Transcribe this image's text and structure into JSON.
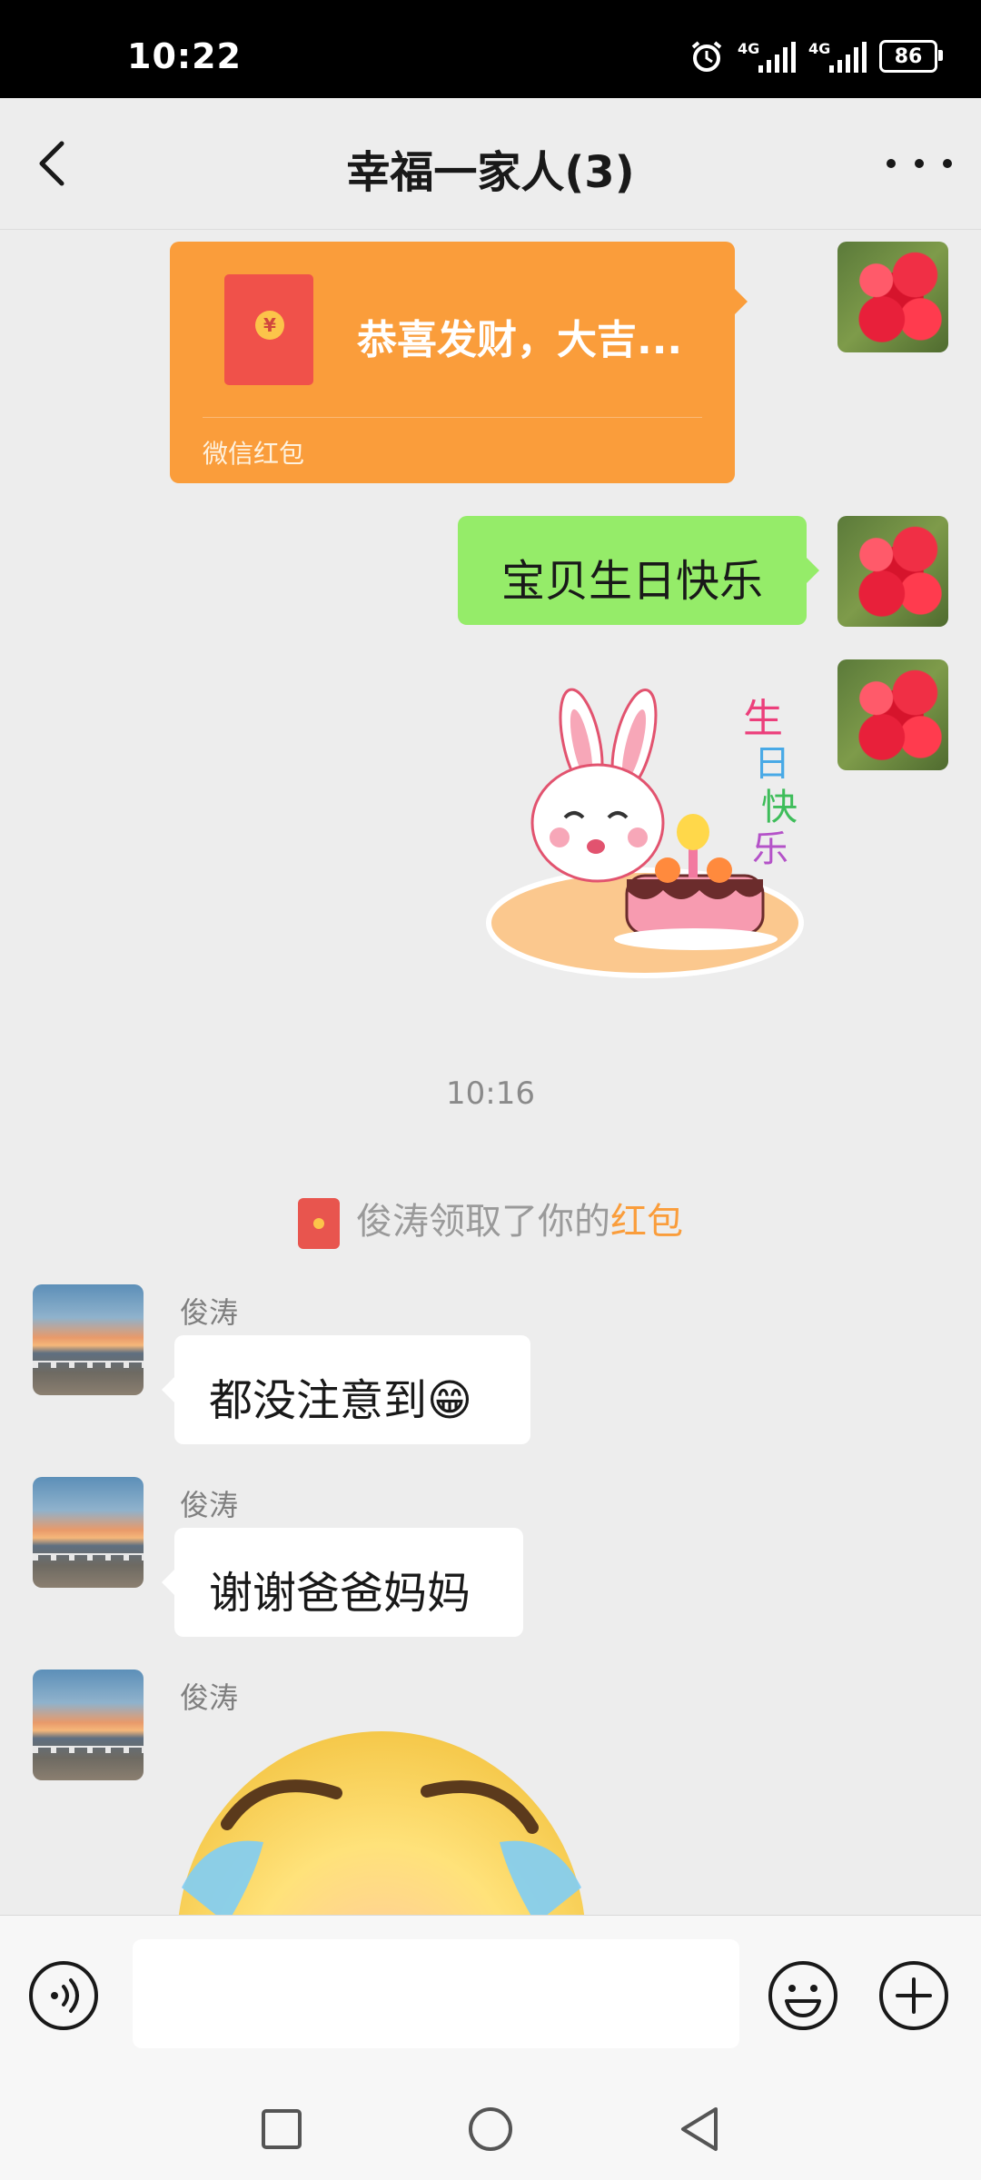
{
  "status_bar": {
    "time": "10:22",
    "network_1": "4G",
    "network_2": "4G",
    "battery": "86",
    "icons": [
      "alarm-icon",
      "signal-icon",
      "signal-icon",
      "battery-icon"
    ]
  },
  "header": {
    "title": "幸福一家人(3)",
    "back_icon": "chevron-left-icon",
    "more_icon": "more-dots-icon"
  },
  "messages": {
    "red_packet": {
      "greeting": "恭喜发财，大吉...",
      "label": "微信红包"
    },
    "text_out": "宝贝生日快乐",
    "sticker": "birthday-rabbit-sticker",
    "timestamp": "10:16",
    "system": {
      "prefix": "俊涛领取了你的",
      "accent": "红包"
    },
    "incoming": [
      {
        "sender": "俊涛",
        "text": "都没注意到😁"
      },
      {
        "sender": "俊涛",
        "text": "谢谢爸爸妈妈"
      },
      {
        "sender": "俊涛",
        "text": ""
      }
    ],
    "big_emoji": "crying-face-sticker"
  },
  "input_bar": {
    "placeholder": "",
    "voice_icon": "voice-icon",
    "emoji_icon": "emoji-icon",
    "plus_icon": "plus-icon"
  },
  "nav_bar": {
    "icons": [
      "recent-apps-icon",
      "home-icon",
      "back-icon"
    ]
  },
  "colors": {
    "accent_orange": "#fa9d3b",
    "bubble_green": "#95ec69",
    "chat_bg": "#ededed"
  }
}
